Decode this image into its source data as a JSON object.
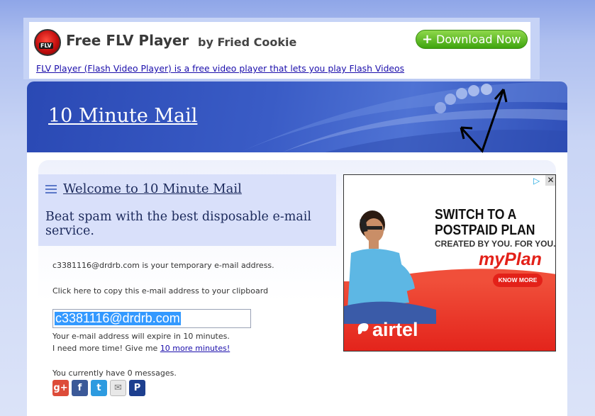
{
  "top_ad": {
    "logo_text": "FLV",
    "title": "Free FLV Player",
    "byline": "by Fried Cookie",
    "download_label": "Download Now",
    "link_text": "FLV Player (Flash Video Player) is a free video player that lets you play Flash Videos"
  },
  "header": {
    "site_title": "10 Minute Mail"
  },
  "welcome": {
    "title": "Welcome to 10 Minute Mail",
    "tagline": "Beat spam with the best disposable e-mail service."
  },
  "mailbox": {
    "address_info": "c3381116@drdrb.com is your temporary e-mail address.",
    "copy_hint": "Click here to copy this e-mail address to your clipboard",
    "email_value": "c3381116@drdrb.com",
    "expire_text": "Your e-mail address will expire in 10 minutes.",
    "more_time_prefix": "I need more time! Give me",
    "more_time_link": "10 more minutes!",
    "messages_text": "You currently have 0 messages."
  },
  "social": [
    {
      "icon": "google-plus-icon",
      "glyph": "g+",
      "color": "#dd4b39"
    },
    {
      "icon": "facebook-icon",
      "glyph": "f",
      "color": "#3b5998"
    },
    {
      "icon": "twitter-icon",
      "glyph": "t",
      "color": "#2d9be0"
    },
    {
      "icon": "email-icon",
      "glyph": "✉",
      "color": "#e8e8e8"
    },
    {
      "icon": "pinterest-icon",
      "glyph": "P",
      "color": "#1d3f8f"
    }
  ],
  "side_ad": {
    "line1": "SWITCH TO A",
    "line2": "POSTPAID PLAN",
    "line3": "CREATED BY YOU. FOR YOU.",
    "brand": "myPlan",
    "cta": "KNOW MORE",
    "company": "airtel"
  },
  "colors": {
    "header_blue": "#2a49b4",
    "link": "#1a0dab",
    "download_green": "#3ea40e",
    "airtel_red": "#e32119"
  }
}
